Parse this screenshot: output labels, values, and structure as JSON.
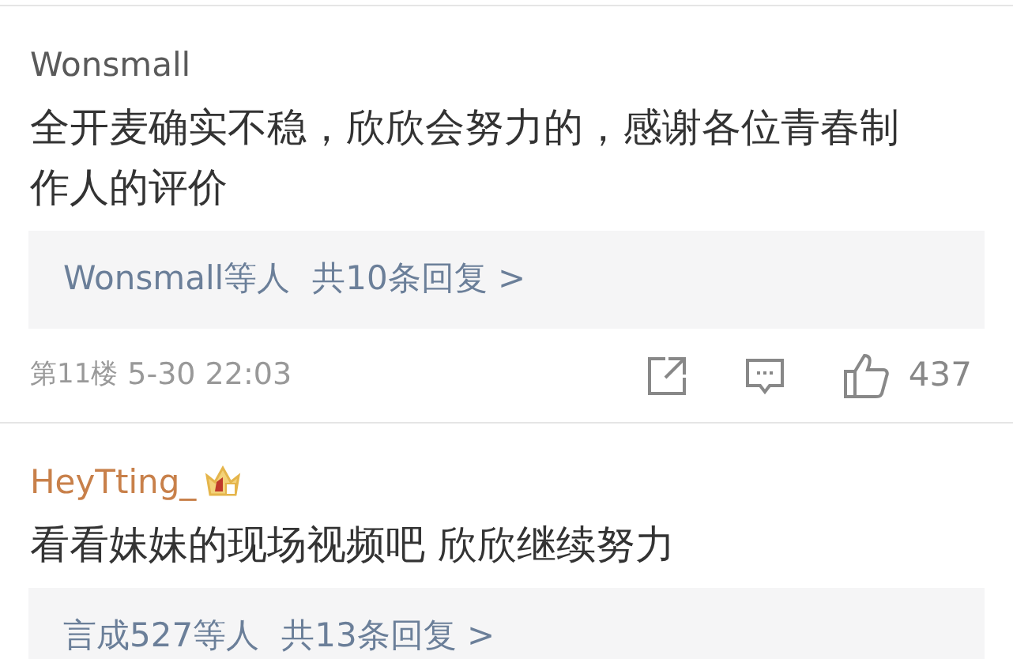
{
  "comments": [
    {
      "user": "Wonsmall",
      "color": "#5a5a5a",
      "crowned": false,
      "text": "全开麦确实不稳，欣欣会努力的，感谢各位青春制作人的评价",
      "reply_users": "Wonsmall等人",
      "reply_count": "共10条回复 >",
      "floor": "第11楼",
      "time": "5-30 22:03",
      "likes": "437"
    },
    {
      "user": "HeyTting_",
      "color": "#c8804a",
      "crowned": true,
      "text": "看看妹妹的现场视频吧 欣欣继续努力",
      "reply_users": "言成527等人",
      "reply_count": "共13条回复 >"
    }
  ]
}
